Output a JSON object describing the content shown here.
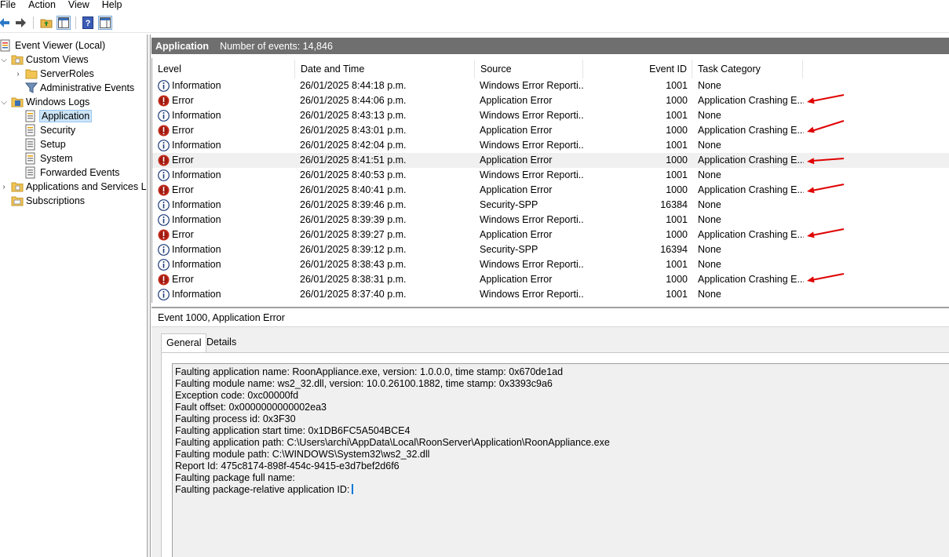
{
  "menu": [
    "File",
    "Action",
    "View",
    "Help"
  ],
  "toolbar_icons": [
    "back-icon",
    "forward-icon",
    "up-folder-icon",
    "show-hide-tree-icon",
    "help-icon",
    "properties-icon"
  ],
  "tree": {
    "root": "Event Viewer (Local)",
    "custom_views": "Custom Views",
    "server_roles": "ServerRoles",
    "admin_events": "Administrative Events",
    "windows_logs": "Windows Logs",
    "application": "Application",
    "security": "Security",
    "setup": "Setup",
    "system": "System",
    "forwarded": "Forwarded Events",
    "apps_services": "Applications and Services Lo",
    "subscriptions": "Subscriptions"
  },
  "list_header": {
    "log_name": "Application",
    "count_text": "Number of events: 14,846"
  },
  "columns": {
    "level": "Level",
    "date": "Date and Time",
    "source": "Source",
    "event_id": "Event ID",
    "task": "Task Category"
  },
  "events": [
    {
      "level": "Information",
      "date": "26/01/2025 8:44:18 p.m.",
      "source": "Windows Error Reporti...",
      "id": "1001",
      "task": "None",
      "type": "info"
    },
    {
      "level": "Error",
      "date": "26/01/2025 8:44:06 p.m.",
      "source": "Application Error",
      "id": "1000",
      "task": "Application Crashing E...",
      "type": "error"
    },
    {
      "level": "Information",
      "date": "26/01/2025 8:43:13 p.m.",
      "source": "Windows Error Reporti...",
      "id": "1001",
      "task": "None",
      "type": "info"
    },
    {
      "level": "Error",
      "date": "26/01/2025 8:43:01 p.m.",
      "source": "Application Error",
      "id": "1000",
      "task": "Application Crashing E...",
      "type": "error"
    },
    {
      "level": "Information",
      "date": "26/01/2025 8:42:04 p.m.",
      "source": "Windows Error Reporti...",
      "id": "1001",
      "task": "None",
      "type": "info"
    },
    {
      "level": "Error",
      "date": "26/01/2025 8:41:51 p.m.",
      "source": "Application Error",
      "id": "1000",
      "task": "Application Crashing E...",
      "type": "error",
      "highlighted": true
    },
    {
      "level": "Information",
      "date": "26/01/2025 8:40:53 p.m.",
      "source": "Windows Error Reporti...",
      "id": "1001",
      "task": "None",
      "type": "info"
    },
    {
      "level": "Error",
      "date": "26/01/2025 8:40:41 p.m.",
      "source": "Application Error",
      "id": "1000",
      "task": "Application Crashing E...",
      "type": "error"
    },
    {
      "level": "Information",
      "date": "26/01/2025 8:39:46 p.m.",
      "source": "Security-SPP",
      "id": "16384",
      "task": "None",
      "type": "info"
    },
    {
      "level": "Information",
      "date": "26/01/2025 8:39:39 p.m.",
      "source": "Windows Error Reporti...",
      "id": "1001",
      "task": "None",
      "type": "info"
    },
    {
      "level": "Error",
      "date": "26/01/2025 8:39:27 p.m.",
      "source": "Application Error",
      "id": "1000",
      "task": "Application Crashing E...",
      "type": "error"
    },
    {
      "level": "Information",
      "date": "26/01/2025 8:39:12 p.m.",
      "source": "Security-SPP",
      "id": "16394",
      "task": "None",
      "type": "info"
    },
    {
      "level": "Information",
      "date": "26/01/2025 8:38:43 p.m.",
      "source": "Windows Error Reporti...",
      "id": "1001",
      "task": "None",
      "type": "info"
    },
    {
      "level": "Error",
      "date": "26/01/2025 8:38:31 p.m.",
      "source": "Application Error",
      "id": "1000",
      "task": "Application Crashing E...",
      "type": "error"
    },
    {
      "level": "Information",
      "date": "26/01/2025 8:37:40 p.m.",
      "source": "Windows Error Reporti...",
      "id": "1001",
      "task": "None",
      "type": "info"
    }
  ],
  "detail": {
    "title": "Event 1000, Application Error",
    "tabs": [
      "General",
      "Details"
    ],
    "lines": [
      "Faulting application name: RoonAppliance.exe, version: 1.0.0.0, time stamp: 0x670de1ad",
      "Faulting module name: ws2_32.dll, version: 10.0.26100.1882, time stamp: 0x3393c9a6",
      "Exception code: 0xc00000fd",
      "Fault offset: 0x0000000000002ea3",
      "Faulting process id: 0x3F30",
      "Faulting application start time: 0x1DB6FC5A504BCE4",
      "Faulting application path: C:\\Users\\archi\\AppData\\Local\\RoonServer\\Application\\RoonAppliance.exe",
      "Faulting module path: C:\\WINDOWS\\System32\\ws2_32.dll",
      "Report Id: 475c8174-898f-454c-9415-e3d7bef2d6f6",
      "Faulting package full name:",
      "Faulting package-relative application ID:"
    ]
  },
  "colors": {
    "annotation_arrow": "#e00000",
    "error": "#c42b1c",
    "info": "#1c3a78",
    "header_bar": "#6f6f6f"
  }
}
